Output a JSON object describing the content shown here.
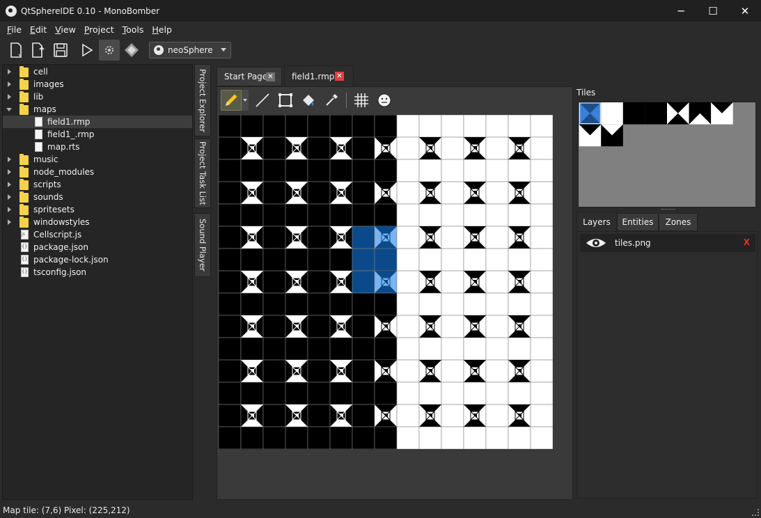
{
  "window": {
    "title": "QtSphereIDE 0.10 - MonoBomber",
    "minimize": "─",
    "maximize": "☐",
    "close": "✕"
  },
  "menu": [
    {
      "label": "File",
      "accel": "F",
      "rest": "ile"
    },
    {
      "label": "Edit",
      "accel": "E",
      "rest": "dit"
    },
    {
      "label": "View",
      "accel": "V",
      "rest": "iew"
    },
    {
      "label": "Project",
      "accel": "P",
      "rest": "roject"
    },
    {
      "label": "Tools",
      "accel": "T",
      "rest": "ools"
    },
    {
      "label": "Help",
      "accel": "H",
      "rest": "elp"
    }
  ],
  "toolbar": {
    "engine": "neoSphere"
  },
  "tree": {
    "items": [
      {
        "label": "cell",
        "type": "folder",
        "expanded": false
      },
      {
        "label": "images",
        "type": "folder",
        "expanded": false
      },
      {
        "label": "lib",
        "type": "folder",
        "expanded": false
      },
      {
        "label": "maps",
        "type": "folder",
        "expanded": true
      },
      {
        "label": "field1.rmp",
        "type": "file",
        "selected": true
      },
      {
        "label": "field1_.rmp",
        "type": "file"
      },
      {
        "label": "map.rts",
        "type": "file"
      },
      {
        "label": "music",
        "type": "folder",
        "expanded": false
      },
      {
        "label": "node_modules",
        "type": "folder",
        "expanded": false
      },
      {
        "label": "scripts",
        "type": "folder",
        "expanded": false
      },
      {
        "label": "sounds",
        "type": "folder",
        "expanded": false
      },
      {
        "label": "spritesets",
        "type": "folder",
        "expanded": false
      },
      {
        "label": "windowstyles",
        "type": "folder",
        "expanded": false
      },
      {
        "label": "Cellscript.js",
        "type": "js"
      },
      {
        "label": "package.json",
        "type": "json"
      },
      {
        "label": "package-lock.json",
        "type": "json"
      },
      {
        "label": "tsconfig.json",
        "type": "json"
      }
    ]
  },
  "side_tabs": [
    "Project Explorer",
    "Project Task List",
    "Sound Player"
  ],
  "doc_tabs": [
    {
      "label": "Start Page",
      "active": false
    },
    {
      "label": "field1.rmp",
      "active": true
    }
  ],
  "map_tools": [
    "pencil-icon",
    "line-icon",
    "rectangle-icon",
    "fill-icon",
    "eyedropper-icon",
    "grid-icon",
    "entity-icon"
  ],
  "map": {
    "columns": 15,
    "rows": 15,
    "selected_tiles": [
      "6,5",
      "7,5",
      "6,6",
      "7,6",
      "6,7",
      "7,7"
    ]
  },
  "right_panel": {
    "tiles_label": "Tiles",
    "tabs": [
      {
        "label": "Layers",
        "active": true
      },
      {
        "label": "Entities",
        "active": false
      },
      {
        "label": "Zones",
        "active": false
      }
    ],
    "layers": [
      {
        "name": "tiles.png",
        "delete": "X"
      }
    ]
  },
  "status": {
    "text": "Map tile: (7,6) Pixel: (225,212)"
  }
}
